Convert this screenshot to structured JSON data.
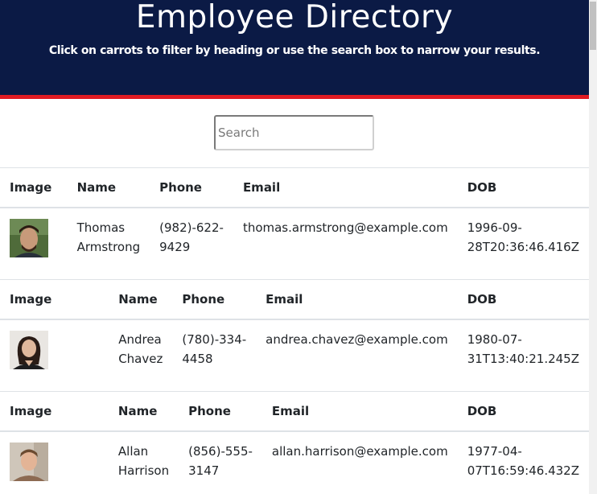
{
  "header": {
    "title": "Employee Directory",
    "subtitle": "Click on carrots to filter by heading or use the search box to narrow your results."
  },
  "search": {
    "placeholder": "Search",
    "value": ""
  },
  "columns": {
    "image": "Image",
    "name": "Name",
    "phone": "Phone",
    "email": "Email",
    "dob": "DOB"
  },
  "employees": [
    {
      "first": "Thomas",
      "last": "Armstrong",
      "phone_a": "(982)-622-",
      "phone_b": "9429",
      "email": "thomas.armstrong@example.com",
      "dob_a": "1996-09-",
      "dob_b": "28T20:36:46.416Z"
    },
    {
      "first": "Andrea",
      "last": "Chavez",
      "phone_a": "(780)-334-",
      "phone_b": "4458",
      "email": "andrea.chavez@example.com",
      "dob_a": "1980-07-",
      "dob_b": "31T13:40:21.245Z"
    },
    {
      "first": "Allan",
      "last": "Harrison",
      "phone_a": "(856)-555-",
      "phone_b": "3147",
      "email": "allan.harrison@example.com",
      "dob_a": "1977-04-",
      "dob_b": "07T16:59:46.432Z"
    }
  ],
  "colors": {
    "header_bg": "#0b1a45",
    "header_accent": "#e11b22",
    "border": "#dee2e6"
  }
}
